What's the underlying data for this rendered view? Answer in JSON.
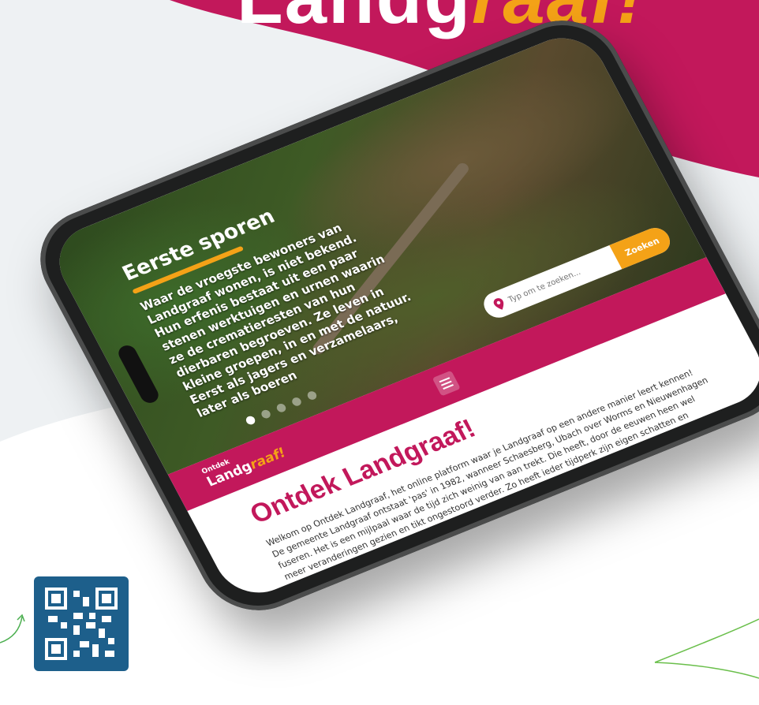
{
  "headline": {
    "part1": "Landg",
    "part2": "raaf!"
  },
  "hero": {
    "title": "Eerste sporen",
    "text": "Waar de vroegste bewoners van Landgraaf wonen, is niet bekend. Hun erfenis bestaat uit een paar stenen werktuigen en urnen waarin ze de crematieresten van hun dierbaren begroeven. Ze leven in kleine groepen, in en met de natuur. Eerst als jagers en verzamelaars, later als boeren"
  },
  "search": {
    "placeholder": "Typ om te zoeken...",
    "button": "Zoeken"
  },
  "slider": {
    "count": 5,
    "active": 1
  },
  "nav": {
    "logo_small": "Ontdek",
    "logo_main": "Landg",
    "logo_accent": "raaf!"
  },
  "content": {
    "title": "Ontdek Landgraaf!",
    "body": "Welkom op Ontdek Landgraaf, het online platform waar je Landgraaf op een andere manier leert kennen! De gemeente Landgraaf ontstaat 'pas' in 1982, wanneer Schaesberg, Ubach over Worms en Nieuwenhagen fuseren. Het is een mijlpaal waar de tijd zich weinig van aan trekt. Die heeft, door de eeuwen heen wel meer veranderingen gezien en tikt ongestoord verder. Zo heeft ieder tijdperk zijn eigen schatten en verhalen nagelaten, die je op Ontdek Landgraaf terug kunt vinden. Vanuit je luie stoel of tijdens een fiets- of wandeltocht die je ... en laat je verrassen door ruim"
  },
  "colors": {
    "magenta": "#c2185b",
    "orange": "#f4a217",
    "qr": "#1d5f8b"
  }
}
